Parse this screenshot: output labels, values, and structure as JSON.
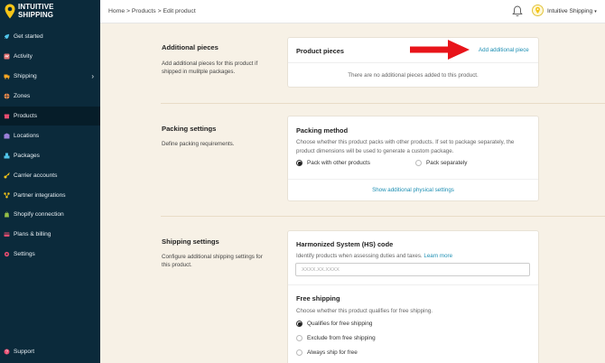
{
  "brand": {
    "line1": "INTUITIVE",
    "line2": "SHIPPING"
  },
  "sidebar": {
    "items": [
      {
        "label": "Get started",
        "icon": "rocket-icon"
      },
      {
        "label": "Activity",
        "icon": "activity-icon"
      },
      {
        "label": "Shipping",
        "icon": "shipping-icon",
        "has_submenu": true
      },
      {
        "label": "Zones",
        "icon": "zones-icon"
      },
      {
        "label": "Products",
        "icon": "products-icon",
        "active": true
      },
      {
        "label": "Locations",
        "icon": "locations-icon"
      },
      {
        "label": "Packages",
        "icon": "packages-icon"
      },
      {
        "label": "Carrier accounts",
        "icon": "key-icon"
      },
      {
        "label": "Partner integrations",
        "icon": "integrations-icon"
      },
      {
        "label": "Shopify connection",
        "icon": "shopify-icon"
      },
      {
        "label": "Plans & billing",
        "icon": "billing-icon"
      },
      {
        "label": "Settings",
        "icon": "gear-icon"
      }
    ],
    "support": "Support"
  },
  "header": {
    "breadcrumb": "Home > Products > Edit product",
    "account_name": "Intuitive Shipping",
    "account_caret": "▾"
  },
  "additional_pieces": {
    "title": "Additional pieces",
    "description": "Add additional pieces for this product if shipped in mulitple packages.",
    "card_title": "Product pieces",
    "add_link": "Add additional piece",
    "empty_text": "There are no additional pieces added to this product."
  },
  "packing": {
    "title": "Packing settings",
    "description": "Define packing requirements.",
    "card_title": "Packing method",
    "card_text": "Choose whether this product packs with other products. If set to package separately, the product dimensions will be used to generate a custom package.",
    "option_with_others": "Pack with other products",
    "option_separately": "Pack separately",
    "selected": "Pack with other products",
    "more_link": "Show additional physical settings"
  },
  "shipping": {
    "title": "Shipping settings",
    "description": "Configure additional shipping settings for this product.",
    "hs_title": "Harmonized System (HS) code",
    "hs_text": "Identify products when assessing duties and taxes.",
    "learn_more": "Learn more",
    "hs_placeholder": "XXXX.XX.XXXX",
    "free_title": "Free shipping",
    "free_text": "Choose whether this product qualifies for free shipping.",
    "free_options": [
      "Qualifies for free shipping",
      "Exclude from free shipping",
      "Always ship for free"
    ],
    "free_selected": "Qualifies for free shipping"
  },
  "colors": {
    "sidebar": "#0b2a3b",
    "background": "#f7f1e6",
    "link": "#1d8fb3",
    "arrow": "#e8141a",
    "logo": "#f5c518"
  }
}
